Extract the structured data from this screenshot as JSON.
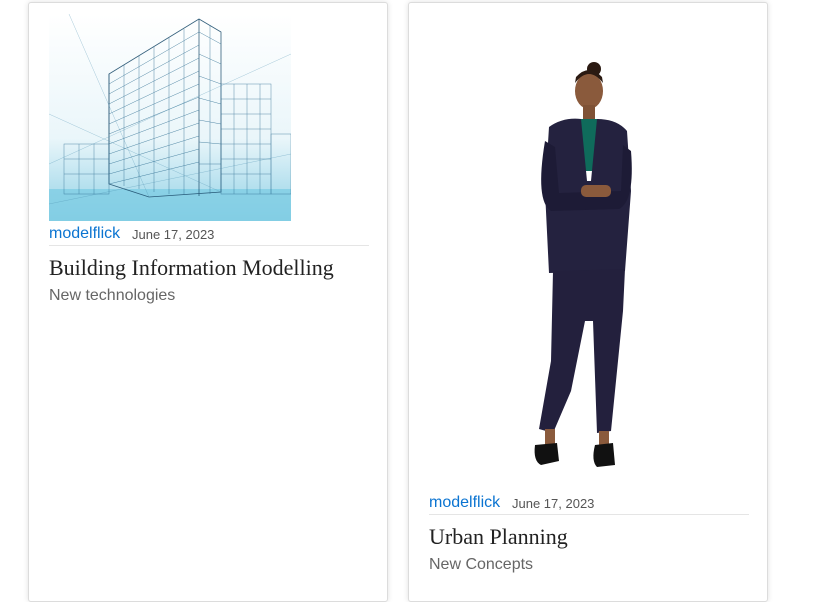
{
  "colors": {
    "link": "#0b74d1",
    "date": "#555555",
    "title": "#222222",
    "subtitle": "#666666"
  },
  "posts": [
    {
      "image": "building-wireframe-image",
      "author": "modelflick",
      "date": "June 17, 2023",
      "title": "Building Information Modelling",
      "subtitle": "New technologies"
    },
    {
      "image": "woman-in-suit-image",
      "author": "modelflick",
      "date": "June 17, 2023",
      "title": "Urban Planning",
      "subtitle": "New Concepts"
    }
  ]
}
